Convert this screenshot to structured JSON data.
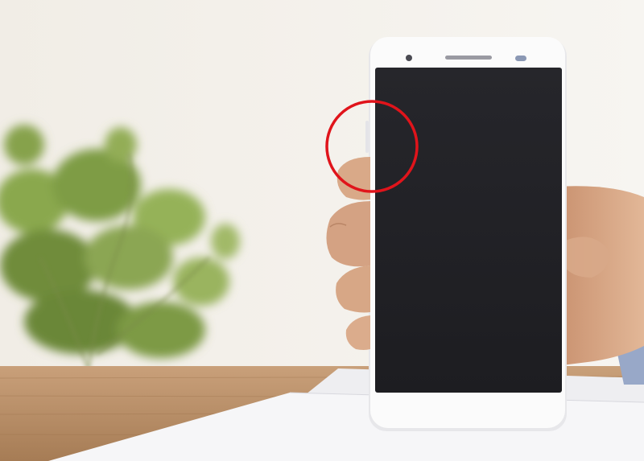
{
  "scene": {
    "subject": "hand-holding-smartphone",
    "colors": {
      "wall": "#f3f0ea",
      "table_wood": "#b8916a",
      "paper": "#f7f7f9",
      "phone_body": "#fbfbfb",
      "phone_screen": "#222227",
      "skin": "#dcae8e",
      "sleeve": "#98a8c8",
      "plant_leaf": "#7d9b44",
      "highlight_circle": "#e0141b"
    },
    "icons": [
      "front-camera-icon",
      "earpiece-speaker-icon",
      "proximity-sensor-icon"
    ],
    "annotation": "red-circle-highlight-on-phone-left-edge"
  }
}
